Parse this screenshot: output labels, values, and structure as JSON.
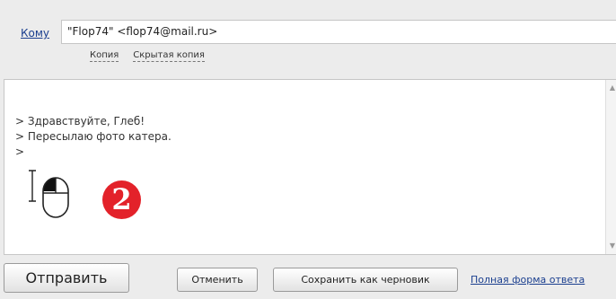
{
  "compose": {
    "to_label": "Кому",
    "to_value": "\"Flop74\" <flop74@mail.ru>",
    "cc_link": "Копия",
    "bcc_link": "Скрытая копия"
  },
  "body": {
    "lines": [
      "> Здравствуйте, Глеб!",
      "> Пересылаю фото катера.",
      ">"
    ]
  },
  "badge": {
    "number": "2",
    "color": "#e3222a"
  },
  "buttons": {
    "send": "Отправить",
    "cancel": "Отменить",
    "save_draft": "Сохранить как черновик",
    "full_form": "Полная форма ответа"
  },
  "icons": [
    "text-cursor-icon",
    "mouse-left-click-icon",
    "scroll-up-icon",
    "scroll-down-icon"
  ]
}
